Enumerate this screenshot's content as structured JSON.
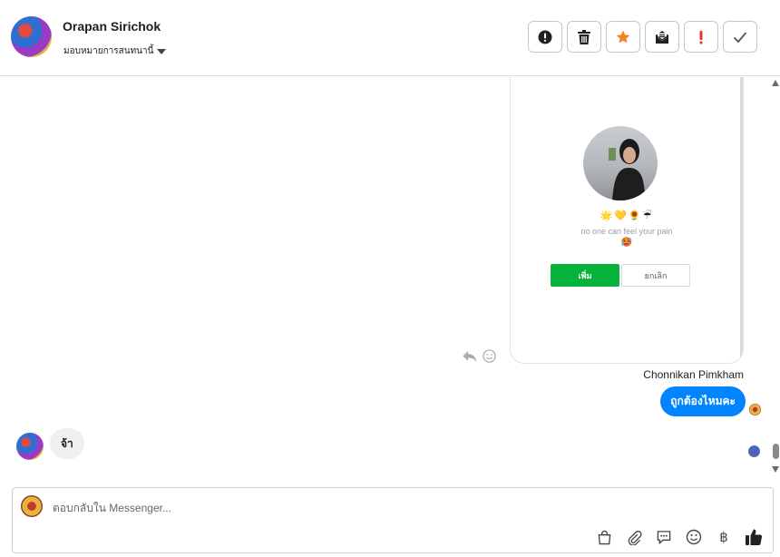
{
  "header": {
    "contact_name": "Orapan Sirichok",
    "assign_label": "มอบหมายการสนทนานี้"
  },
  "toolbar": {
    "buttons": [
      "alert-circle-icon",
      "trash-icon",
      "star-icon",
      "mark-unread-icon",
      "spam-icon",
      "done-check-icon"
    ],
    "star_color": "#f5821f",
    "spam_color": "#e4362b"
  },
  "conversation": {
    "shared_screenshot": {
      "emoji_row": "🌟💛🌻☔",
      "bio": "no one can feel your pain",
      "bio_emoji": "🥵",
      "add_button": "เพิ่ม",
      "cancel_button": "ยกเลิก"
    },
    "outgoing": {
      "sender_name": "Chonnikan Pimkham",
      "text": "ถูกต้องไหมคะ"
    },
    "incoming": {
      "text": "จ้า"
    }
  },
  "composer": {
    "placeholder": "ตอบกลับใน Messenger...",
    "baht_symbol": "฿"
  },
  "colors": {
    "accent_blue": "#0084ff",
    "add_green": "#06b33a"
  }
}
